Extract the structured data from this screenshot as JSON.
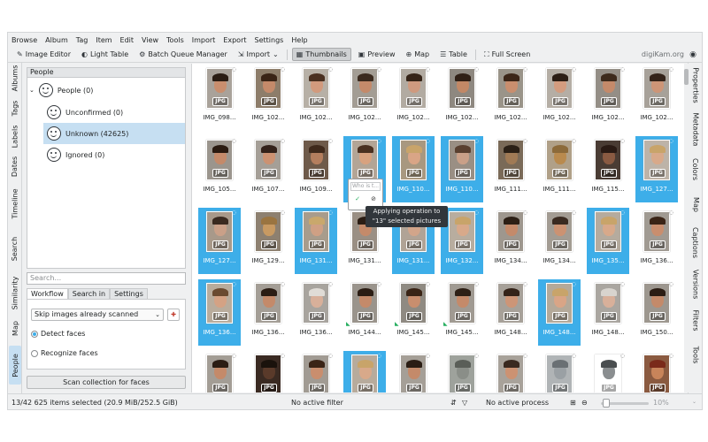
{
  "menu": [
    "Browse",
    "Album",
    "Tag",
    "Item",
    "Edit",
    "View",
    "Tools",
    "Import",
    "Export",
    "Settings",
    "Help"
  ],
  "toolbar": {
    "image_editor": "Image Editor",
    "light_table": "Light Table",
    "batch_queue": "Batch Queue Manager",
    "import": "Import",
    "thumbnails": "Thumbnails",
    "preview": "Preview",
    "map": "Map",
    "table": "Table",
    "full_screen": "Full Screen",
    "brand": "digiKam.org"
  },
  "left_tabs": [
    "Albums",
    "Tags",
    "Labels",
    "Dates",
    "Timeline",
    "Search",
    "Similarity",
    "Map",
    "People"
  ],
  "right_tabs": [
    "Properties",
    "Metadata",
    "Colors",
    "Map",
    "Captions",
    "Versions",
    "Filters",
    "Tools"
  ],
  "people": {
    "header": "People",
    "root": "People (0)",
    "items": [
      "Unconfirmed (0)",
      "Unknown (42625)",
      "Ignored (0)"
    ]
  },
  "search_placeholder": "Search...",
  "workflow": {
    "tabs": [
      "Workflow",
      "Search in",
      "Settings"
    ],
    "skip_option": "Skip images already scanned",
    "detect": "Detect faces",
    "recognize": "Recognize faces",
    "scan_button": "Scan collection for faces"
  },
  "thumbnails": [
    {
      "name": "IMG_098...",
      "sel": false,
      "c": "#c98e6e",
      "h": "#2b1d14",
      "bg": "#a9a29a"
    },
    {
      "name": "IMG_102...",
      "sel": false,
      "c": "#c48a6a",
      "h": "#3a2416",
      "bg": "#8d7d6a"
    },
    {
      "name": "IMG_102...",
      "sel": false,
      "c": "#d29a7d",
      "h": "#4a3020",
      "bg": "#b7b0a6"
    },
    {
      "name": "IMG_102...",
      "sel": false,
      "c": "#c48a6a",
      "h": "#3b2a1e",
      "bg": "#a39d94"
    },
    {
      "name": "IMG_102...",
      "sel": false,
      "c": "#cf9a7f",
      "h": "#362418",
      "bg": "#b2aba2"
    },
    {
      "name": "IMG_102...",
      "sel": false,
      "c": "#c28866",
      "h": "#302016",
      "bg": "#8e8880"
    },
    {
      "name": "IMG_102...",
      "sel": false,
      "c": "#c98e6e",
      "h": "#3c2618",
      "bg": "#9a9489"
    },
    {
      "name": "IMG_102...",
      "sel": false,
      "c": "#d39c7f",
      "h": "#2c1e15",
      "bg": "#b5aea5"
    },
    {
      "name": "IMG_102...",
      "sel": false,
      "c": "#c48a6a",
      "h": "#3d2a1c",
      "bg": "#948e86"
    },
    {
      "name": "IMG_102...",
      "sel": false,
      "c": "#cd9577",
      "h": "#342319",
      "bg": "#a7a199"
    },
    {
      "name": "IMG_105...",
      "sel": false,
      "c": "#c48a6a",
      "h": "#2a1a10",
      "bg": "#9b958d"
    },
    {
      "name": "IMG_107...",
      "sel": false,
      "c": "#cc9272",
      "h": "#33221a",
      "bg": "#a59f97"
    },
    {
      "name": "IMG_109...",
      "sel": false,
      "c": "#b47e5e",
      "h": "#402a1c",
      "bg": "#6e5a4a"
    },
    {
      "name": "IMG_110...",
      "sel": true,
      "c": "#d8a27f",
      "h": "#4a3020",
      "bg": "#b3a596"
    },
    {
      "name": "IMG_110...",
      "sel": true,
      "c": "#d9a586",
      "h": "#c8a46a",
      "bg": "#a89880"
    },
    {
      "name": "IMG_110...",
      "sel": true,
      "c": "#caa088",
      "h": "#5a4030",
      "bg": "#9a8f84"
    },
    {
      "name": "IMG_111...",
      "sel": false,
      "c": "#a07a55",
      "h": "#2b2016",
      "bg": "#7a6a58"
    },
    {
      "name": "IMG_111...",
      "sel": false,
      "c": "#b98a4e",
      "h": "#8c6a3a",
      "bg": "#b0a088"
    },
    {
      "name": "IMG_115...",
      "sel": false,
      "c": "#8a5a42",
      "h": "#2a1a14",
      "bg": "#4a3c34"
    },
    {
      "name": "IMG_127...",
      "sel": true,
      "c": "#d8a98a",
      "h": "#c8a46a",
      "bg": "#bdb3a8"
    },
    {
      "name": "IMG_127...",
      "sel": true,
      "c": "#caa088",
      "h": "#3a2a20",
      "bg": "#a8998a"
    },
    {
      "name": "IMG_129...",
      "sel": false,
      "c": "#c89a62",
      "h": "#9a7440",
      "bg": "#8d8070"
    },
    {
      "name": "IMG_131...",
      "sel": true,
      "c": "#cfa084",
      "h": "#c9a86c",
      "bg": "#a89c8c"
    },
    {
      "name": "IMG_131...",
      "sel": false,
      "c": "#c48a6a",
      "h": "#2b1d14",
      "bg": "#9a8f84"
    },
    {
      "name": "IMG_131...",
      "sel": true,
      "c": "#d2a58a",
      "h": "#3c2a1c",
      "bg": "#b0a396"
    },
    {
      "name": "IMG_132...",
      "sel": true,
      "c": "#d8a98a",
      "h": "#c8a46a",
      "bg": "#b8ad9f"
    },
    {
      "name": "IMG_134...",
      "sel": false,
      "c": "#c48a6a",
      "h": "#2c1f15",
      "bg": "#9e978e"
    },
    {
      "name": "IMG_134...",
      "sel": false,
      "c": "#cc9272",
      "h": "#3a2a20",
      "bg": "#a39c93"
    },
    {
      "name": "IMG_135...",
      "sel": true,
      "c": "#d8a98a",
      "h": "#c8a46a",
      "bg": "#b5ab9e"
    },
    {
      "name": "IMG_136...",
      "sel": false,
      "c": "#c98e6e",
      "h": "#3a2416",
      "bg": "#a09a92"
    },
    {
      "name": "IMG_136...",
      "sel": true,
      "c": "#d4a284",
      "h": "#6a4a30",
      "bg": "#b9ac9c"
    },
    {
      "name": "IMG_136...",
      "sel": false,
      "c": "#c48a6a",
      "h": "#2b1d14",
      "bg": "#a49e96"
    },
    {
      "name": "IMG_136...",
      "sel": false,
      "c": "#d8b09a",
      "h": "#e0dcd6",
      "bg": "#a8a49e"
    },
    {
      "name": "IMG_144...",
      "sel": false,
      "c": "#c48a6a",
      "h": "#2b1d14",
      "bg": "#9a948c",
      "flag": true
    },
    {
      "name": "IMG_145...",
      "sel": false,
      "c": "#c98e6e",
      "h": "#3a2416",
      "bg": "#8f8a82",
      "flag": true
    },
    {
      "name": "IMG_145...",
      "sel": false,
      "c": "#c48a6a",
      "h": "#2e2016",
      "bg": "#a09a92",
      "flag": true
    },
    {
      "name": "IMG_148...",
      "sel": false,
      "c": "#cd9577",
      "h": "#342319",
      "bg": "#a7a199"
    },
    {
      "name": "IMG_148...",
      "sel": true,
      "c": "#d9a586",
      "h": "#c8a46a",
      "bg": "#b4a999"
    },
    {
      "name": "IMG_148...",
      "sel": false,
      "c": "#d8b09a",
      "h": "#d8d4ce",
      "bg": "#aaa6a0"
    },
    {
      "name": "IMG_150...",
      "sel": false,
      "c": "#c48a6a",
      "h": "#2b1d14",
      "bg": "#9d978f"
    },
    {
      "name": "",
      "sel": false,
      "c": "#c48a6a",
      "h": "#2b1d14",
      "bg": "#a39d95"
    },
    {
      "name": "",
      "sel": false,
      "c": "#5a3a2a",
      "h": "#1a120c",
      "bg": "#3a2a22"
    },
    {
      "name": "",
      "sel": false,
      "c": "#c98e6e",
      "h": "#3a2416",
      "bg": "#a19b93"
    },
    {
      "name": "",
      "sel": true,
      "c": "#d8a98a",
      "h": "#c8a46a",
      "bg": "#b7ab9c"
    },
    {
      "name": "",
      "sel": false,
      "c": "#c48a6a",
      "h": "#2b1d14",
      "bg": "#a59f97"
    },
    {
      "name": "",
      "sel": false,
      "c": "#8a8e88",
      "h": "#5a5e58",
      "bg": "#9ea29c"
    },
    {
      "name": "",
      "sel": false,
      "c": "#cc9272",
      "h": "#3a2a20",
      "bg": "#a8a29a"
    },
    {
      "name": "",
      "sel": false,
      "c": "#9aa0a4",
      "h": "#6a7074",
      "bg": "#b0b4b6"
    },
    {
      "name": "",
      "sel": false,
      "c": "#8a8e90",
      "h": "#4a4e50",
      "bg": "#9a9e a0"
    },
    {
      "name": "",
      "sel": false,
      "c": "#c8845a",
      "h": "#7a2a1a",
      "bg": "#8a5a40"
    }
  ],
  "face_editor": {
    "placeholder": "Who is t...",
    "ok": "✓",
    "delete": "⊘"
  },
  "tooltip": {
    "line1": "Applying operation to",
    "line2": "\"13\" selected pictures"
  },
  "status": {
    "selection": "13/42 625 items selected (20.9 MiB/252.5 GiB)",
    "filter": "No active filter",
    "process": "No active process",
    "zoom": "10%",
    "zoom_fraction": 0.05
  }
}
